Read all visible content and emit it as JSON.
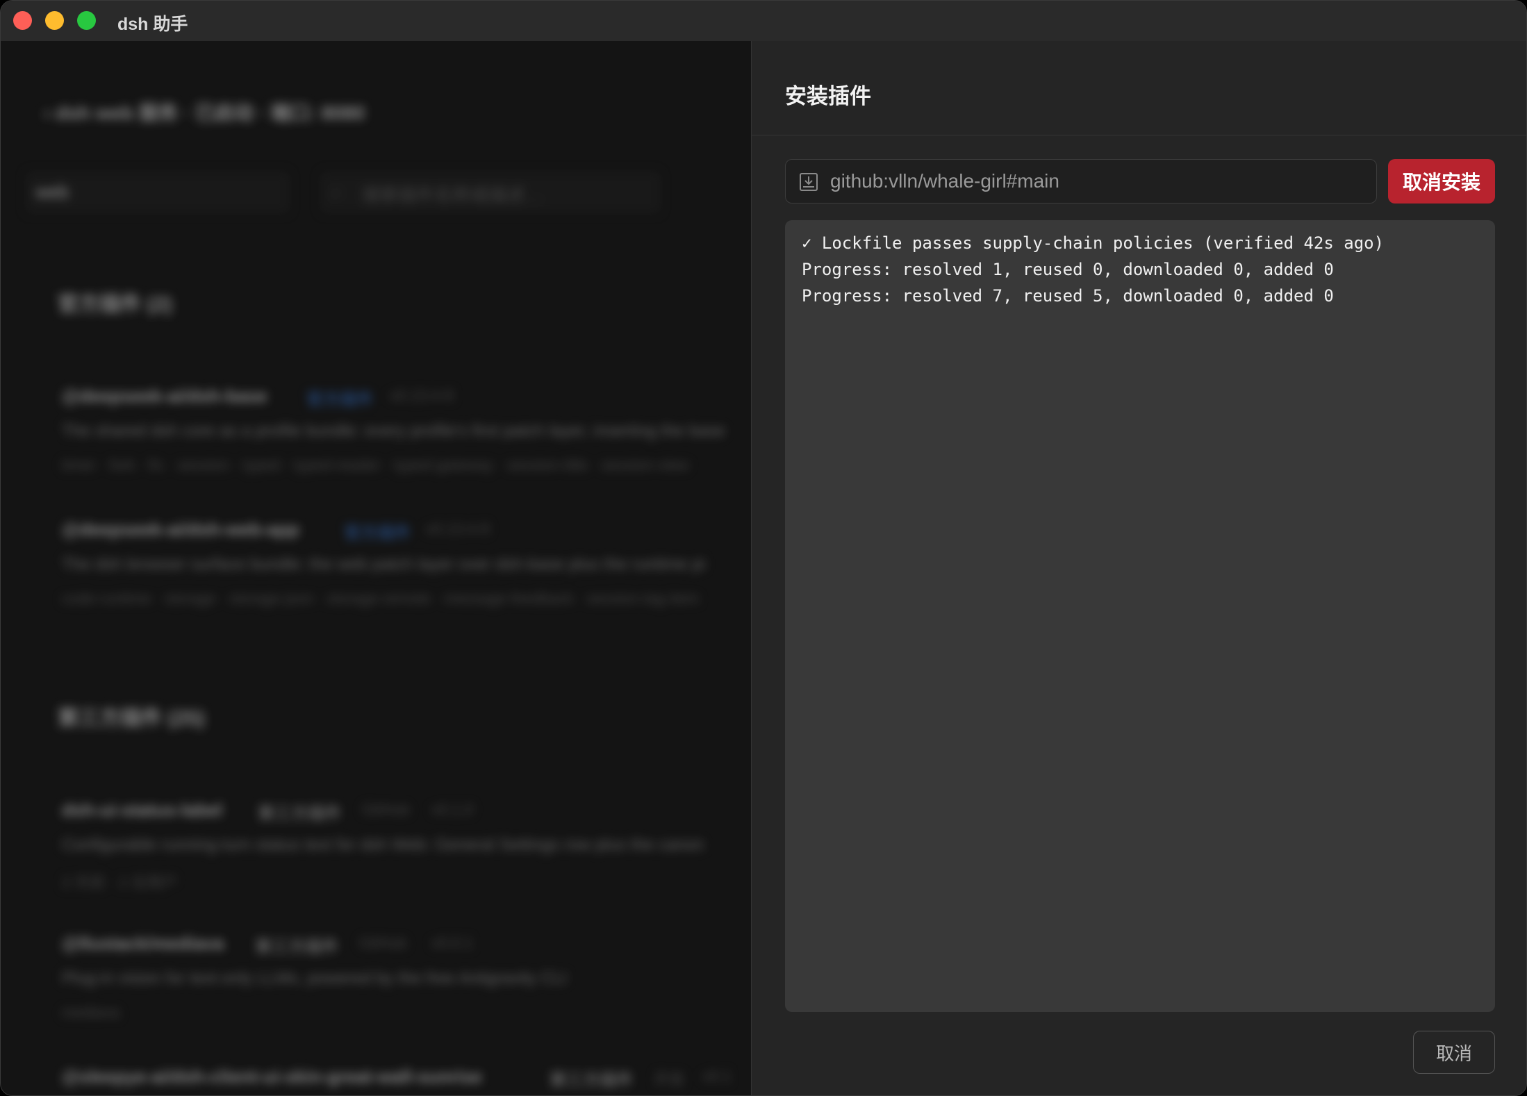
{
  "window": {
    "title": "dsh 助手"
  },
  "background": {
    "breadcrumb": "‹ dsh web 服务   ·   已启动   ·   端口: 8080",
    "filter_value": "web",
    "search_placeholder": "搜索插件名称或描述…",
    "section_official": "官方插件  (2)",
    "section_third_party": "第三方插件  (25)",
    "official_plugins": [
      {
        "name": "@deepseek-ai/dsh-base",
        "tag": "官方插件",
        "version": "v0.13.4-8",
        "desc": "The shared dsh core as a profile bundle: every profile's first patch layer, inserting the base",
        "keywords": "timer · fork · fix · session · typed · typed-reader · typed-gateway · session-title · session-view"
      },
      {
        "name": "@deepseek-ai/dsh-web-app",
        "tag": "官方插件",
        "version": "v0.13.4-8",
        "desc": "The dsh browser surface bundle: the web patch layer over dsh-base plus the runtime pi",
        "keywords": "code-runtime · storage · storage-json · storage-remote · message-feedback · session-tag-item"
      }
    ],
    "third_party_plugins": [
      {
        "name": "dsh-ui-status-label",
        "tag": "第三方插件",
        "source": "GitHub",
        "version": "v0.1.0",
        "desc": "Configurable running-turn status text for dsh Web: General Settings row plus the canon",
        "meta": "2 天前 · 1 位用户"
      },
      {
        "name": "@llustack/mediava",
        "tag": "第三方插件",
        "source": "GitHub",
        "version": "v0.0.1",
        "desc": "Plug-in vision for text-only LLMs, powered by the free Antigravity CLI",
        "meta": "mediava"
      },
      {
        "name": "@sleepye-ai/dsh-client-ui-skin-great-wall-sunrise",
        "tag": "第三方插件",
        "source": "开发",
        "version": "v0.1",
        "desc": "",
        "meta": ""
      }
    ]
  },
  "drawer": {
    "title": "安装插件",
    "input_value": "github:vlln/whale-girl#main",
    "cancel_install_label": "取消安装",
    "log_lines": [
      "✓ Lockfile passes supply-chain policies (verified 42s ago)",
      "Progress: resolved 1, reused 0, downloaded 0, added 0",
      "Progress: resolved 7, reused 5, downloaded 0, added 0"
    ],
    "cancel_label": "取消"
  },
  "icons": {
    "input_icon": "package-install-icon"
  },
  "colors": {
    "danger": "#b8232e",
    "accent": "#3b7bd8",
    "log_bg": "#393939"
  }
}
